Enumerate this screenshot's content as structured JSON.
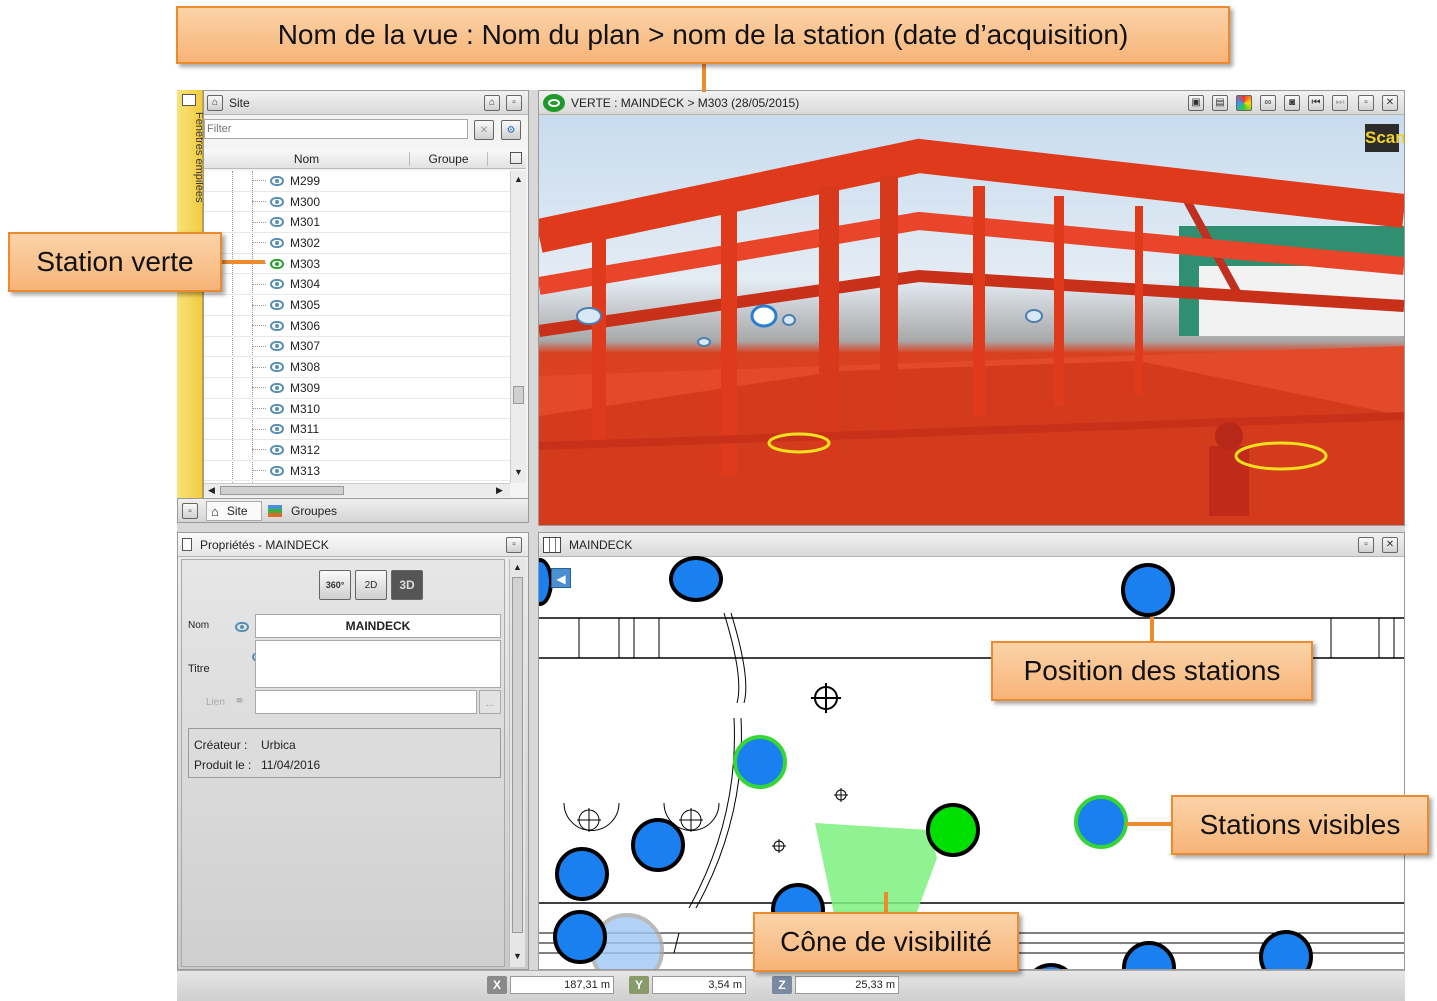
{
  "callouts": {
    "view_name": "Nom de la vue : Nom du plan > nom de la station (date d’acquisition)",
    "green_station": "Station verte",
    "station_positions": "Position des stations",
    "visible_stations": "Stations visibles",
    "visibility_cone": "Cône de visibilité"
  },
  "left_strip": {
    "label": "Fenêtres empilées"
  },
  "site_panel": {
    "title": "Site",
    "filter_placeholder": "Filter",
    "columns": [
      "Nom",
      "Groupe"
    ],
    "rows": [
      "M299",
      "M300",
      "M301",
      "M302",
      "M303",
      "M304",
      "M305",
      "M306",
      "M307",
      "M308",
      "M309",
      "M310",
      "M311",
      "M312",
      "M313"
    ],
    "selected": "M303",
    "tabs": {
      "site": "Site",
      "groups": "Groupes"
    }
  },
  "view_panel": {
    "title": "VERTE : MAINDECK > M303 (28/05/2015)",
    "scan_badge": "Scan"
  },
  "props_panel": {
    "title": "Propriétés - MAINDECK",
    "toolbar": [
      "360°",
      "2D",
      "3D"
    ],
    "nom_label": "Nom",
    "nom_value": "MAINDECK",
    "titre_label": "Titre",
    "titre_value": "",
    "lien_label": "Lien",
    "lien_value": "",
    "browse_label": "...",
    "createur_label": "Créateur :",
    "createur_value": "Urbica",
    "produit_label": "Produit le :",
    "produit_value": "11/04/2016"
  },
  "plan_panel": {
    "title": "MAINDECK"
  },
  "statusbar": {
    "x_label": "X",
    "x_value": "187,31 m",
    "y_label": "Y",
    "y_value": "3,54 m",
    "z_label": "Z",
    "z_value": "25,33 m"
  },
  "colors": {
    "callout_fill": "#f7b478",
    "callout_border": "#ec8a2e",
    "station_blue": "#1a80f0",
    "station_visible_ring": "#37d637",
    "cone_green": "#7ef07e"
  }
}
